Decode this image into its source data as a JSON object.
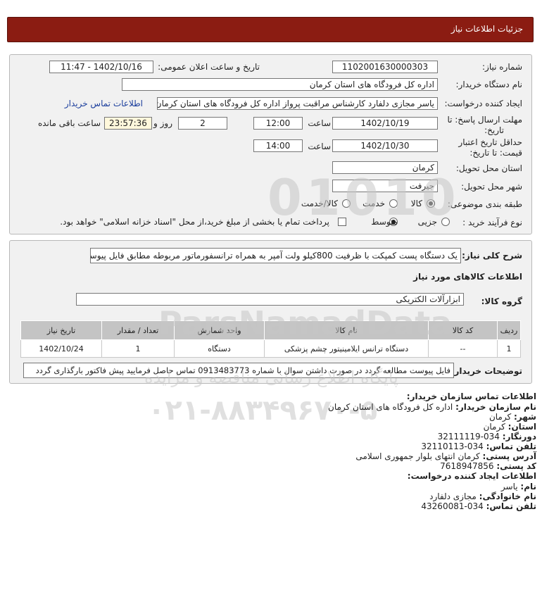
{
  "header": {
    "title": "جزئیات اطلاعات نیاز"
  },
  "form": {
    "need_number_label": "شماره نیاز:",
    "need_number": "1102001630000303",
    "announce_label": "تاریخ و ساعت اعلان عمومی:",
    "announce_value": "1402/10/16 - 11:47",
    "buyer_org_label": "نام دستگاه خریدار:",
    "buyer_org": "اداره کل فرودگاه های استان کرمان",
    "creator_label": "ایجاد کننده درخواست:",
    "creator": "یاسر مجازی دلفارد کارشناس مراقبت پرواز اداره کل فرودگاه های استان کرمان",
    "contact_link": "اطلاعات تماس خریدار",
    "deadline_label_1": "مهلت ارسال پاسخ: تا",
    "deadline_label_2": "تاریخ:",
    "deadline_date": "1402/10/19",
    "time_label": "ساعت",
    "deadline_time": "12:00",
    "days_value": "2",
    "days_label": "روز و",
    "remaining_time": "23:57:36",
    "remaining_label": "ساعت باقی مانده",
    "validity_label_1": "حداقل تاریخ اعتبار",
    "validity_label_2": "قیمت: تا تاریخ:",
    "validity_date": "1402/10/30",
    "validity_time": "14:00",
    "province_label": "استان محل تحویل:",
    "province": "کرمان",
    "city_label": "شهر محل تحویل:",
    "city": "جیرفت",
    "category_label": "طبقه بندی موضوعی:",
    "category_options": [
      "کالا",
      "خدمت",
      "کالا/خدمت"
    ],
    "category_selected": "کالا",
    "process_label": "نوع فرآیند خرید :",
    "process_options": [
      "جزیی",
      "متوسط"
    ],
    "process_selected": "متوسط",
    "payment_note": "پرداخت تمام یا بخشی از مبلغ خرید،از محل \"اسناد خزانه اسلامی\" خواهد بود."
  },
  "description": {
    "label": "شرح کلی نیاز:",
    "text": "یک دستگاه پست کمپکت با ظرفیت 800کیلو ولت آمپر به همراه ترانسفورماتور مربوطه مطابق فایل پیوست"
  },
  "goods": {
    "section_title": "اطلاعات کالاهای مورد نیاز",
    "group_label": "گروه کالا:",
    "group_value": "ابزارآلات الکتریکی",
    "columns": [
      "ردیف",
      "کد کالا",
      "نام کالا",
      "واحد شمارش",
      "تعداد / مقدار",
      "تاریخ نیاز"
    ],
    "rows": [
      [
        "1",
        "--",
        "دستگاه ترانس ایلامینیتور چشم پزشکی",
        "دستگاه",
        "1",
        "1402/10/24"
      ]
    ]
  },
  "buyer_notes": {
    "label": "توضیحات خریدار:",
    "text": "فایل پیوست مطالعه گردد در صورت داشتن سوال با شماره 0913483773 تماس حاصل فرمایید پیش فاکتور بارگذاری گردد"
  },
  "contact": {
    "title": "اطلاعات تماس سازمان خریدار:",
    "org_label": "نام سازمان خریدار:",
    "org": "اداره کل فرودگاه های استان کرمان",
    "city_label": "شهر:",
    "city": "کرمان",
    "province_label": "استان:",
    "province": "کرمان",
    "fax_label": "دورنگار:",
    "fax": "034-32111119",
    "phone_label": "تلفن تماس:",
    "phone": "034-32110113",
    "address_label": "آدرس پستی:",
    "address": "کرمان انتهای بلوار جمهوری اسلامی",
    "postal_label": "کد پستی:",
    "postal": "7618947856",
    "creator_title": "اطلاعات ایجاد کننده درخواست:",
    "first_name_label": "نام:",
    "first_name": "یاسر",
    "last_name_label": "نام خانوادگی:",
    "last_name": "مجازی دلفارد",
    "creator_phone_label": "تلفن تماس:",
    "creator_phone": "034-43260081"
  },
  "watermark": {
    "brand": "ParsNamadData",
    "tagline": "پایگاه اطلاع رسانی مناقصه و مزایده",
    "phone": "۰۲۱-۸۸۳۴۹۶۷۰-۵",
    "digits": "01010"
  }
}
